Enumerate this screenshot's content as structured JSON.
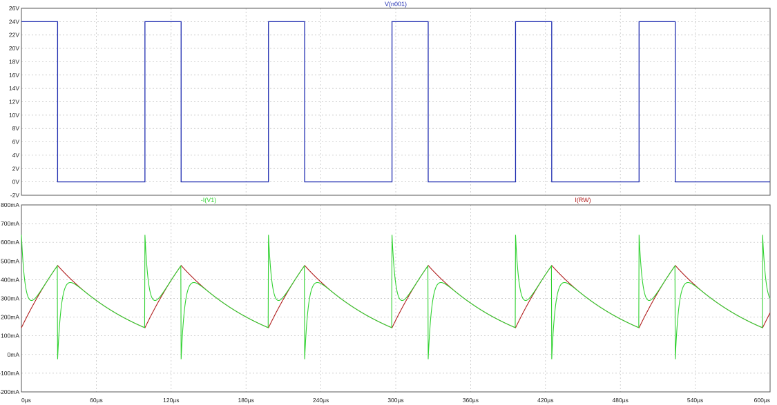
{
  "chart_data": [
    {
      "type": "line",
      "title": "V(n001)",
      "xlim": [
        0,
        600
      ],
      "ylim": [
        -2,
        26
      ],
      "x_ticks": [
        "0µs",
        "60µs",
        "120µs",
        "180µs",
        "240µs",
        "300µs",
        "360µs",
        "420µs",
        "480µs",
        "540µs",
        "600µs"
      ],
      "y_ticks": [
        "-2V",
        "0V",
        "2V",
        "4V",
        "6V",
        "8V",
        "10V",
        "12V",
        "14V",
        "16V",
        "18V",
        "20V",
        "22V",
        "24V",
        "26V"
      ],
      "grid": true,
      "colors": {
        "series": "#1f2cb0"
      },
      "series": [
        {
          "name": "V(n001)",
          "x": [
            0,
            29,
            29,
            99,
            99,
            128,
            128,
            198,
            198,
            227,
            227,
            297,
            297,
            326,
            326,
            396,
            396,
            425,
            425,
            495,
            495,
            524,
            524,
            600
          ],
          "y": [
            24,
            24,
            0,
            0,
            24,
            24,
            0,
            0,
            24,
            24,
            0,
            0,
            24,
            24,
            0,
            0,
            24,
            24,
            0,
            0,
            24,
            24,
            0,
            0
          ]
        }
      ]
    },
    {
      "type": "line",
      "title_series": [
        "-I(V1)",
        "I(RW)"
      ],
      "xlim": [
        0,
        600
      ],
      "ylim": [
        -200,
        800
      ],
      "x_ticks": [
        "0µs",
        "60µs",
        "120µs",
        "180µs",
        "240µs",
        "300µs",
        "360µs",
        "420µs",
        "480µs",
        "540µs",
        "600µs"
      ],
      "y_ticks": [
        "-200mA",
        "-100mA",
        "0mA",
        "100mA",
        "200mA",
        "300mA",
        "400mA",
        "500mA",
        "600mA",
        "700mA",
        "800mA"
      ],
      "grid": true,
      "colors": {
        "-I(V1)": "#2fd12f",
        "I(RW)": "#b01c1c"
      },
      "period": 99,
      "on_time": 29,
      "cycle_start_times": [
        0,
        99,
        198,
        297,
        396,
        495
      ],
      "series": [
        {
          "name": "I(RW)",
          "on_phase": {
            "start": 143,
            "end": 476
          },
          "off_phase": {
            "start": 476,
            "end": 143
          }
        },
        {
          "name": "-I(V1)",
          "on_phase": {
            "start": 640,
            "dip": 330,
            "end": 476
          },
          "off_phase": {
            "start": -25,
            "overshoot": 345,
            "end": 143
          }
        }
      ]
    }
  ]
}
